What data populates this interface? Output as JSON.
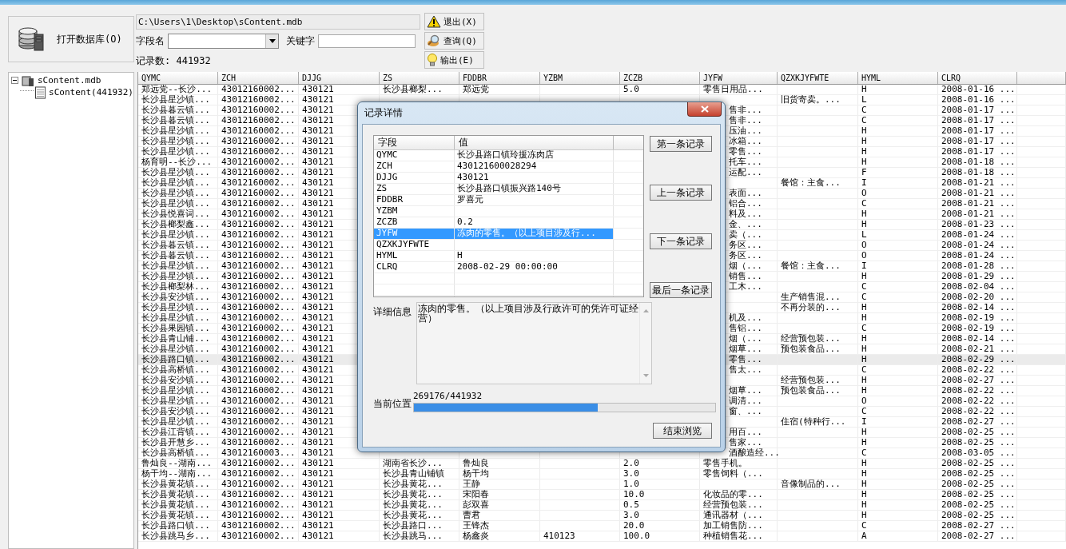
{
  "toolbar": {
    "open_button": "打开数据库(O)",
    "path": "C:\\Users\\1\\Desktop\\sContent.mdb",
    "field_label": "字段名",
    "keyword_label": "关键字",
    "count": "记录数: 441932",
    "buttons": [
      {
        "label": "退出(X)",
        "kind": "exit"
      },
      {
        "label": "查询(Q)",
        "kind": "query"
      },
      {
        "label": "输出(E)",
        "kind": "export"
      }
    ]
  },
  "tree": {
    "items": [
      {
        "label": "sContent.mdb",
        "expanded": true,
        "children": [
          {
            "label": "sContent(441932)"
          }
        ]
      }
    ]
  },
  "table": {
    "columns": [
      "QYMC",
      "ZCH",
      "DJJG",
      "ZS",
      "FDDBR",
      "YZBM",
      "ZCZB",
      "JYFW",
      "QZXKJYFWTE",
      "HYML",
      "CLRQ"
    ],
    "rows": [
      {
        "cells": [
          "郑远党--长沙...",
          "43012160002...",
          "430121",
          "长沙县榔梨...",
          "郑远党",
          null,
          "5.0",
          "零售日用品...",
          null,
          "H",
          "2008-01-16 ..."
        ],
        "selected": false
      },
      {
        "cells": [
          "长沙县星沙镇...",
          "43012160002...",
          "430121",
          null,
          null,
          null,
          null,
          null,
          "旧货寄卖。...",
          "L",
          "2008-01-16 ..."
        ],
        "selected": false
      },
      {
        "cells": [
          "长沙县暮云镇...",
          "43012160002...",
          "430121",
          null,
          null,
          null,
          null,
          "售非...",
          null,
          "C",
          "2008-01-17 ..."
        ],
        "selected": false
      },
      {
        "cells": [
          "长沙县暮云镇...",
          "43012160002...",
          "430121",
          null,
          null,
          null,
          null,
          "售非...",
          null,
          "C",
          "2008-01-17 ..."
        ],
        "selected": false
      },
      {
        "cells": [
          "长沙县星沙镇...",
          "43012160002...",
          "430121",
          null,
          null,
          null,
          null,
          "压油...",
          null,
          "H",
          "2008-01-17 ..."
        ],
        "selected": false
      },
      {
        "cells": [
          "长沙县星沙镇...",
          "43012160002...",
          "430121",
          null,
          null,
          null,
          null,
          "冰箱...",
          null,
          "H",
          "2008-01-17 ..."
        ],
        "selected": false
      },
      {
        "cells": [
          "长沙县星沙镇...",
          "43012160002...",
          "430121",
          null,
          null,
          null,
          null,
          "零售...",
          null,
          "H",
          "2008-01-17 ..."
        ],
        "selected": false
      },
      {
        "cells": [
          "杨育明--长沙...",
          "43012160002...",
          "430121",
          null,
          null,
          null,
          null,
          "托车...",
          null,
          "H",
          "2008-01-18 ..."
        ],
        "selected": false
      },
      {
        "cells": [
          "长沙县星沙镇...",
          "43012160002...",
          "430121",
          null,
          null,
          null,
          null,
          "运配...",
          null,
          "F",
          "2008-01-18 ..."
        ],
        "selected": false
      },
      {
        "cells": [
          "长沙县星沙镇...",
          "43012160002...",
          "430121",
          null,
          null,
          null,
          null,
          null,
          "餐馆：主食...",
          "I",
          "2008-01-21 ..."
        ],
        "selected": false
      },
      {
        "cells": [
          "长沙县星沙镇...",
          "43012160002...",
          "430121",
          null,
          null,
          null,
          null,
          "表面...",
          null,
          "O",
          "2008-01-21 ..."
        ],
        "selected": false
      },
      {
        "cells": [
          "长沙县星沙镇...",
          "43012160002...",
          "430121",
          null,
          null,
          null,
          null,
          "铝合...",
          null,
          "C",
          "2008-01-21 ..."
        ],
        "selected": false
      },
      {
        "cells": [
          "长沙县悦喜词...",
          "43012160002...",
          "430121",
          null,
          null,
          null,
          null,
          "料及...",
          null,
          "H",
          "2008-01-21 ..."
        ],
        "selected": false
      },
      {
        "cells": [
          "长沙县榔梨鑫...",
          "43012160002...",
          "430121",
          null,
          null,
          null,
          null,
          "金、...",
          null,
          "H",
          "2008-01-23 ..."
        ],
        "selected": false
      },
      {
        "cells": [
          "长沙县星沙镇...",
          "43012160002...",
          "430121",
          null,
          null,
          null,
          null,
          "卖（...",
          null,
          "L",
          "2008-01-24 ..."
        ],
        "selected": false
      },
      {
        "cells": [
          "长沙县暮云镇...",
          "43012160002...",
          "430121",
          null,
          null,
          null,
          null,
          "务区...",
          null,
          "O",
          "2008-01-24 ..."
        ],
        "selected": false
      },
      {
        "cells": [
          "长沙县暮云镇...",
          "43012160002...",
          "430121",
          null,
          null,
          null,
          null,
          "务区...",
          null,
          "O",
          "2008-01-24 ..."
        ],
        "selected": false
      },
      {
        "cells": [
          "长沙县星沙镇...",
          "43012160002...",
          "430121",
          null,
          null,
          null,
          null,
          "烟（...",
          "餐馆：主食...",
          "I",
          "2008-01-28 ..."
        ],
        "selected": false
      },
      {
        "cells": [
          "长沙县星沙镇...",
          "43012160002...",
          "430121",
          null,
          null,
          null,
          null,
          "销售...",
          null,
          "H",
          "2008-01-29 ..."
        ],
        "selected": false
      },
      {
        "cells": [
          "长沙县榔梨林...",
          "43012160002...",
          "430121",
          null,
          null,
          null,
          null,
          "工木...",
          null,
          "C",
          "2008-02-04 ..."
        ],
        "selected": false
      },
      {
        "cells": [
          "长沙县安沙镇...",
          "43012160002...",
          "430121",
          null,
          null,
          null,
          null,
          null,
          "生产销售混...",
          "C",
          "2008-02-20 ..."
        ],
        "selected": false
      },
      {
        "cells": [
          "长沙县星沙镇...",
          "43012160002...",
          "430121",
          null,
          null,
          null,
          null,
          null,
          "不再分装的...",
          "H",
          "2008-02-14 ..."
        ],
        "selected": false
      },
      {
        "cells": [
          "长沙县星沙镇...",
          "43012160002...",
          "430121",
          null,
          null,
          null,
          null,
          "机及...",
          null,
          "H",
          "2008-02-19 ..."
        ],
        "selected": false
      },
      {
        "cells": [
          "长沙县果园镇...",
          "43012160002...",
          "430121",
          null,
          null,
          null,
          null,
          "售铝...",
          null,
          "C",
          "2008-02-19 ..."
        ],
        "selected": false
      },
      {
        "cells": [
          "长沙县青山铺...",
          "43012160002...",
          "430121",
          null,
          null,
          null,
          null,
          "烟（...",
          "经营预包装...",
          "H",
          "2008-02-14 ..."
        ],
        "selected": false
      },
      {
        "cells": [
          "长沙县星沙镇...",
          "43012160002...",
          "430121",
          null,
          null,
          null,
          null,
          "烟草...",
          "预包装食品...",
          "H",
          "2008-02-21 ..."
        ],
        "selected": false
      },
      {
        "cells": [
          "长沙县路口镇...",
          "43012160002...",
          "430121",
          null,
          null,
          null,
          null,
          "零售...",
          null,
          "H",
          "2008-02-29 ..."
        ],
        "selected": true
      },
      {
        "cells": [
          "长沙县高桥镇...",
          "43012160002...",
          "430121",
          null,
          null,
          null,
          null,
          "售太...",
          null,
          "C",
          "2008-02-22 ..."
        ],
        "selected": false
      },
      {
        "cells": [
          "长沙县安沙镇...",
          "43012160002...",
          "430121",
          null,
          null,
          null,
          null,
          null,
          "经营预包装...",
          "H",
          "2008-02-27 ..."
        ],
        "selected": false
      },
      {
        "cells": [
          "长沙县星沙镇...",
          "43012160002...",
          "430121",
          null,
          null,
          null,
          null,
          "烟草...",
          "预包装食品...",
          "H",
          "2008-02-22 ..."
        ],
        "selected": false
      },
      {
        "cells": [
          "长沙县星沙镇...",
          "43012160002...",
          "430121",
          null,
          null,
          null,
          null,
          "调清...",
          null,
          "O",
          "2008-02-22 ..."
        ],
        "selected": false
      },
      {
        "cells": [
          "长沙县安沙镇...",
          "43012160002...",
          "430121",
          null,
          null,
          null,
          null,
          "窗、...",
          null,
          "C",
          "2008-02-22 ..."
        ],
        "selected": false
      },
      {
        "cells": [
          "长沙县星沙镇...",
          "43012160002...",
          "430121",
          null,
          null,
          null,
          null,
          null,
          "住宿(特种行...",
          "I",
          "2008-02-27 ..."
        ],
        "selected": false
      },
      {
        "cells": [
          "长沙县江背镇...",
          "43012160002...",
          "430121",
          null,
          null,
          null,
          null,
          "用百...",
          null,
          "H",
          "2008-02-25 ..."
        ],
        "selected": false
      },
      {
        "cells": [
          "长沙县开慧乡...",
          "43012160002...",
          "430121",
          null,
          null,
          null,
          null,
          "售家...",
          null,
          "H",
          "2008-02-25 ..."
        ],
        "selected": false
      },
      {
        "cells": [
          "长沙县高桥镇...",
          "43012160003...",
          "430121",
          null,
          null,
          null,
          null,
          "酒酿造经...",
          null,
          "C",
          "2008-03-05 ..."
        ],
        "selected": false
      },
      {
        "cells": [
          "鲁灿良--湖南...",
          "43012160002...",
          "430121",
          "湖南省长沙...",
          "鲁灿良",
          null,
          "2.0",
          "零售手机。",
          null,
          "H",
          "2008-02-25 ..."
        ],
        "selected": false
      },
      {
        "cells": [
          "杨干均--湖南...",
          "43012160002...",
          "430121",
          "长沙县青山铺镇",
          "杨干均",
          null,
          "3.0",
          "零售饲料（...",
          null,
          "H",
          "2008-02-25 ..."
        ],
        "selected": false
      },
      {
        "cells": [
          "长沙县黄花镇...",
          "43012160002...",
          "430121",
          "长沙县黄花...",
          "王静",
          null,
          "1.0",
          null,
          "音像制品的...",
          "H",
          "2008-02-25 ..."
        ],
        "selected": false
      },
      {
        "cells": [
          "长沙县黄花镇...",
          "43012160002...",
          "430121",
          "长沙县黄花...",
          "宋阳春",
          null,
          "10.0",
          "化妆品的零...",
          null,
          "H",
          "2008-02-25 ..."
        ],
        "selected": false
      },
      {
        "cells": [
          "长沙县黄花镇...",
          "43012160002...",
          "430121",
          "长沙县黄花...",
          "彭双喜",
          null,
          "0.5",
          "经营预包装...",
          null,
          "H",
          "2008-02-25 ..."
        ],
        "selected": false
      },
      {
        "cells": [
          "长沙县黄花镇...",
          "43012160002...",
          "430121",
          "长沙县黄花...",
          "曹君",
          null,
          "3.0",
          "通讯器材（...",
          null,
          "H",
          "2008-02-25 ..."
        ],
        "selected": false
      },
      {
        "cells": [
          "长沙县路口镇...",
          "43012160002...",
          "430121",
          "长沙县路口...",
          "王锋杰",
          null,
          "20.0",
          "加工销售防...",
          null,
          "C",
          "2008-02-27 ..."
        ],
        "selected": false
      },
      {
        "cells": [
          "长沙县跳马乡...",
          "43012160002...",
          "430121",
          "长沙县跳马...",
          "杨鑫炎",
          "410123",
          "100.0",
          "种植销售花...",
          null,
          "A",
          "2008-02-27 ..."
        ],
        "selected": false
      }
    ]
  },
  "dialog": {
    "title": "记录详情",
    "columns": [
      "字段",
      "值"
    ],
    "fields": [
      {
        "name": "QYMC",
        "value": "长沙县路口镇玲援冻肉店",
        "selected": false
      },
      {
        "name": "ZCH",
        "value": "430121600028294",
        "selected": false
      },
      {
        "name": "DJJG",
        "value": "430121",
        "selected": false
      },
      {
        "name": "ZS",
        "value": "长沙县路口镇振兴路140号",
        "selected": false
      },
      {
        "name": "FDDBR",
        "value": "罗喜元",
        "selected": false
      },
      {
        "name": "YZBM",
        "selected": false
      },
      {
        "name": "ZCZB",
        "value": "0.2",
        "selected": false
      },
      {
        "name": "JYFW",
        "value": "冻肉的零售。（以上项目涉及行...",
        "selected": true
      },
      {
        "name": "QZXKJYFWTE",
        "selected": false
      },
      {
        "name": "HYML",
        "value": "H",
        "selected": false
      },
      {
        "name": "CLRQ",
        "value": "2008-02-29 00:00:00",
        "selected": false
      }
    ],
    "nav_buttons": [
      "第一条记录",
      "上一条记录",
      "下一条记录",
      "最后一条记录"
    ],
    "detail_label": "详细信息",
    "detail_text": "冻肉的零售。（以上项目涉及行政许可的凭许可证经营）",
    "position_label": "当前位置",
    "position": "269176/441932",
    "level": 0.609,
    "end_button": "结束浏览"
  }
}
